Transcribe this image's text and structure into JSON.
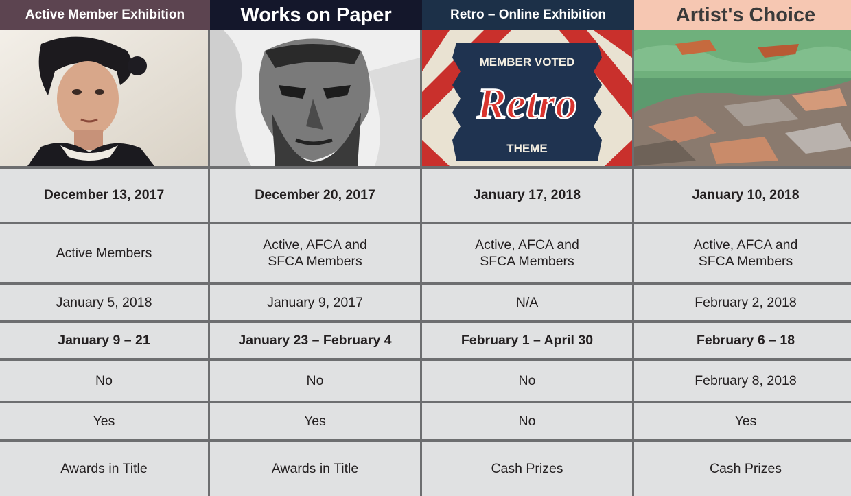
{
  "columns": [
    {
      "header": "Active Member Exhibition",
      "header_bg": "#5c4450",
      "header_color": "#ffffff",
      "header_size": "small",
      "image": "portrait-woman-painting",
      "opening": "December 13, 2017",
      "eligibility": "Active Members",
      "deadline": "January 5, 2018",
      "dates": "January 9 – 21",
      "reception": "No",
      "awards_flag": "Yes",
      "prizes": "Awards in Title"
    },
    {
      "header": "Works on Paper",
      "header_bg": "#14172b",
      "header_color": "#ffffff",
      "header_size": "large",
      "image": "portrait-man-ink-painting",
      "opening": "December 20, 2017",
      "eligibility": "Active, AFCA and\nSFCA Members",
      "deadline": "January 9, 2017",
      "dates": "January 23 – February 4",
      "reception": "No",
      "awards_flag": "Yes",
      "prizes": "Awards in Title"
    },
    {
      "header": "Retro – Online Exhibition",
      "header_bg": "#1c3048",
      "header_color": "#ffffff",
      "header_size": "small",
      "image": "retro-theme-badge",
      "badge_top": "MEMBER VOTED",
      "badge_script": "Retro",
      "badge_bottom": "THEME",
      "opening": "January 17, 2018",
      "eligibility": "Active, AFCA and\nSFCA Members",
      "deadline": "N/A",
      "dates": "February 1 – April 30",
      "reception": "No",
      "awards_flag": "No",
      "prizes": "Cash Prizes"
    },
    {
      "header": "Artist's Choice",
      "header_bg": "#f6c7b2",
      "header_color": "#3a3a3a",
      "header_size": "large",
      "image": "rocky-shore-landscape-painting",
      "opening": "January 10, 2018",
      "eligibility": "Active, AFCA and\nSFCA Members",
      "deadline": "February 2, 2018",
      "dates": "February 6 – 18",
      "reception": "February 8, 2018",
      "awards_flag": "Yes",
      "prizes": "Cash Prizes"
    }
  ],
  "colors": {
    "background": "#6d6e70",
    "cell": "#e0e1e2",
    "text": "#231f20",
    "retro_red": "#c9302c",
    "retro_navy": "#1f3350"
  }
}
